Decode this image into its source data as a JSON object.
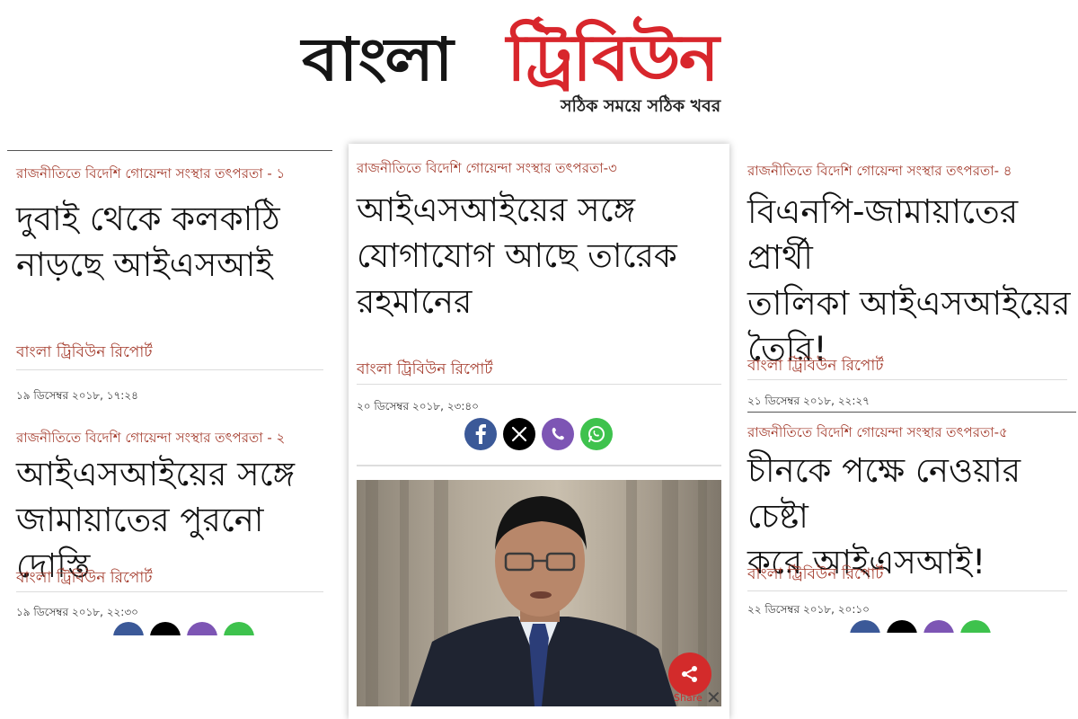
{
  "masthead": {
    "logo_part1": "বাংলা",
    "logo_part2": "ট্রিবিউন",
    "tagline": "সঠিক সময়ে সঠিক খবর"
  },
  "colors": {
    "accent_red": "#d8262c",
    "kicker": "#a33a2b",
    "facebook": "#3b5998",
    "x": "#000000",
    "viber": "#7d55b4",
    "whatsapp": "#3ec24d"
  },
  "left": {
    "article1": {
      "kicker": "রাজনীতিতে বিদেশি গোয়েন্দা সংস্থার তৎপরতা - ১",
      "headline_line1": "দুবাই থেকে কলকাঠি",
      "headline_line2": "নাড়ছে আইএসআই",
      "byline": "বাংলা ট্রিবিউন রিপোর্ট",
      "timestamp": "১৯ ডিসেম্বর ২০১৮, ১৭:২৪"
    },
    "article2": {
      "kicker": "রাজনীতিতে বিদেশি গোয়েন্দা সংস্থার তৎপরতা - ২",
      "headline_line1": "আইএসআইয়ের সঙ্গে",
      "headline_line2": "জামায়াতের পুরনো দোস্তি",
      "byline": "বাংলা ট্রিবিউন রিপোর্ট",
      "timestamp": "১৯ ডিসেম্বর ২০১৮, ২২:৩০"
    }
  },
  "center": {
    "kicker": "রাজনীতিতে বিদেশি গোয়েন্দা সংস্থার তৎপরতা-৩",
    "headline_line1": "আইএসআইয়ের সঙ্গে",
    "headline_line2": "যোগাযোগ আছে তারেক",
    "headline_line3": "রহমানের",
    "byline": "বাংলা ট্রিবিউন রিপোর্ট",
    "timestamp": "২০ ডিসেম্বর ২০১৮, ২৩:৪০",
    "share_label": "Share",
    "icons": [
      "facebook-icon",
      "x-icon",
      "viber-icon",
      "whatsapp-icon",
      "share-icon",
      "close-icon"
    ]
  },
  "right": {
    "article1": {
      "kicker": "রাজনীতিতে বিদেশি গোয়েন্দা সংস্থার তৎপরতা- ৪",
      "headline_line1": "বিএনপি-জামায়াতের প্রার্থী",
      "headline_line2": "তালিকা আইএসআইয়ের",
      "headline_line3": "তৈরি!",
      "byline": "বাংলা ট্রিবিউন রিপোর্ট",
      "timestamp": "২১ ডিসেম্বর ২০১৮, ২২:২৭"
    },
    "article2": {
      "kicker": "রাজনীতিতে বিদেশি গোয়েন্দা সংস্থার তৎপরতা-৫",
      "headline_line1": "চীনকে পক্ষে নেওয়ার চেষ্টা",
      "headline_line2": "করে আইএসআই!",
      "byline": "বাংলা ট্রিবিউন রিপোর্ট",
      "timestamp": "২২ ডিসেম্বর ২০১৮, ২০:১০"
    }
  }
}
